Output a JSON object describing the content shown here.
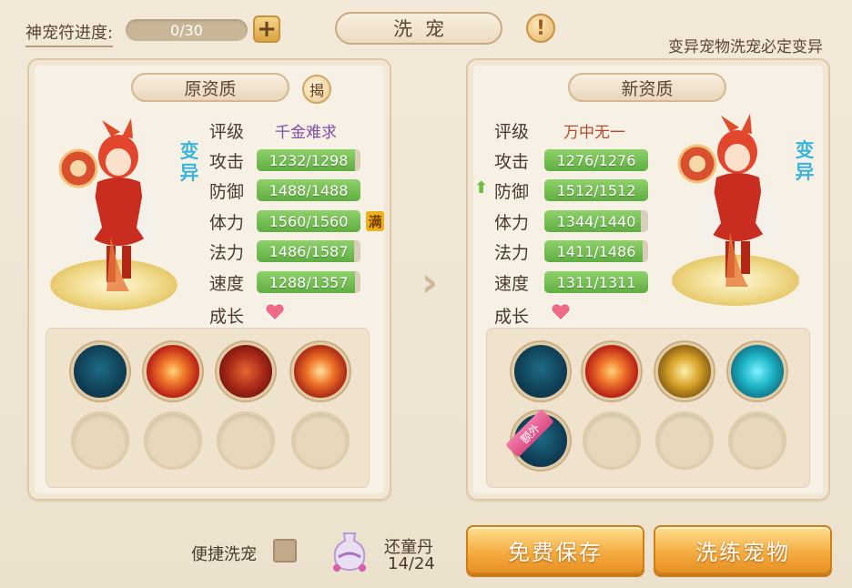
{
  "header": {
    "progress_label": "神宠符进度:",
    "progress_value": "0/30",
    "plus_icon": "plus-icon",
    "title": "洗宠",
    "info_icon": "exclamation-icon",
    "mutation_note": "变异宠物洗宠必定变异"
  },
  "left_panel": {
    "title": "原资质",
    "reveal_label": "揭",
    "mutation_tag": "变异",
    "rating_label": "评级",
    "rating_value": "千金难求",
    "stats": [
      {
        "label": "攻击",
        "value": "1232/1298",
        "fill": 0.95
      },
      {
        "label": "防御",
        "value": "1488/1488",
        "fill": 1.0
      },
      {
        "label": "体力",
        "value": "1560/1560",
        "fill": 1.0
      },
      {
        "label": "法力",
        "value": "1486/1587",
        "fill": 0.94
      },
      {
        "label": "速度",
        "value": "1288/1357",
        "fill": 0.95
      }
    ],
    "full_tag": "满",
    "growth_label": "成长",
    "skills": [
      "teal-swirl-skill-icon",
      "red-vortex-skill-icon",
      "wolf-howl-skill-icon",
      "fire-orb-skill-icon"
    ]
  },
  "right_panel": {
    "title": "新资质",
    "mutation_tag": "变异",
    "rating_label": "评级",
    "rating_value": "万中无一",
    "stats": [
      {
        "label": "攻击",
        "value": "1276/1276",
        "fill": 1.0
      },
      {
        "label": "防御",
        "value": "1512/1512",
        "fill": 1.0
      },
      {
        "label": "体力",
        "value": "1344/1440",
        "fill": 0.93
      },
      {
        "label": "法力",
        "value": "1411/1486",
        "fill": 0.95
      },
      {
        "label": "速度",
        "value": "1311/1311",
        "fill": 1.0
      }
    ],
    "growth_label": "成长",
    "skills": [
      "teal-swirl-skill-icon",
      "red-vortex-skill-icon",
      "golden-paw-skill-icon",
      "cyan-heart-skill-icon",
      "teal-wave-skill-icon"
    ],
    "extra_label": "额外"
  },
  "footer": {
    "quick_wash_label": "便捷洗宠",
    "potion_name": "还童丹",
    "potion_count": "14/24",
    "save_button": "免费保存",
    "refine_button": "洗练宠物"
  },
  "colors": {
    "rating_left": "#7b4fa8",
    "rating_right": "#b34a2a",
    "stat_bar": "#6fbd4c",
    "mutation_tag": "#3cb3d9",
    "button": "#f3aa3c"
  }
}
